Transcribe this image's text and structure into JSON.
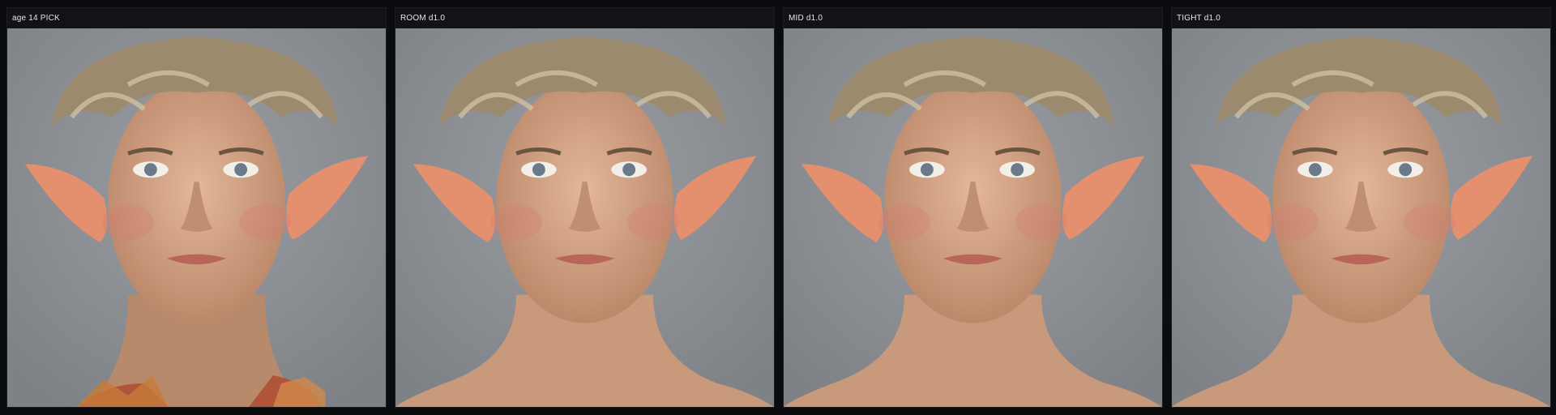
{
  "panels": [
    {
      "label": "age 14 PICK",
      "variant": "with-garment"
    },
    {
      "label": "ROOM d1.0",
      "variant": "bare-shoulders"
    },
    {
      "label": "MID d1.0",
      "variant": "bare-shoulders"
    },
    {
      "label": "TIGHT d1.0",
      "variant": "bare-shoulders"
    }
  ],
  "colors": {
    "page_bg": "#0b0c0e",
    "header_bg": "#121316",
    "header_text": "#e6e6e6",
    "image_bg": "#8e9297",
    "skin": "#d8a88a",
    "hair": "#9c8a6e",
    "ear": "#e48f6e"
  }
}
